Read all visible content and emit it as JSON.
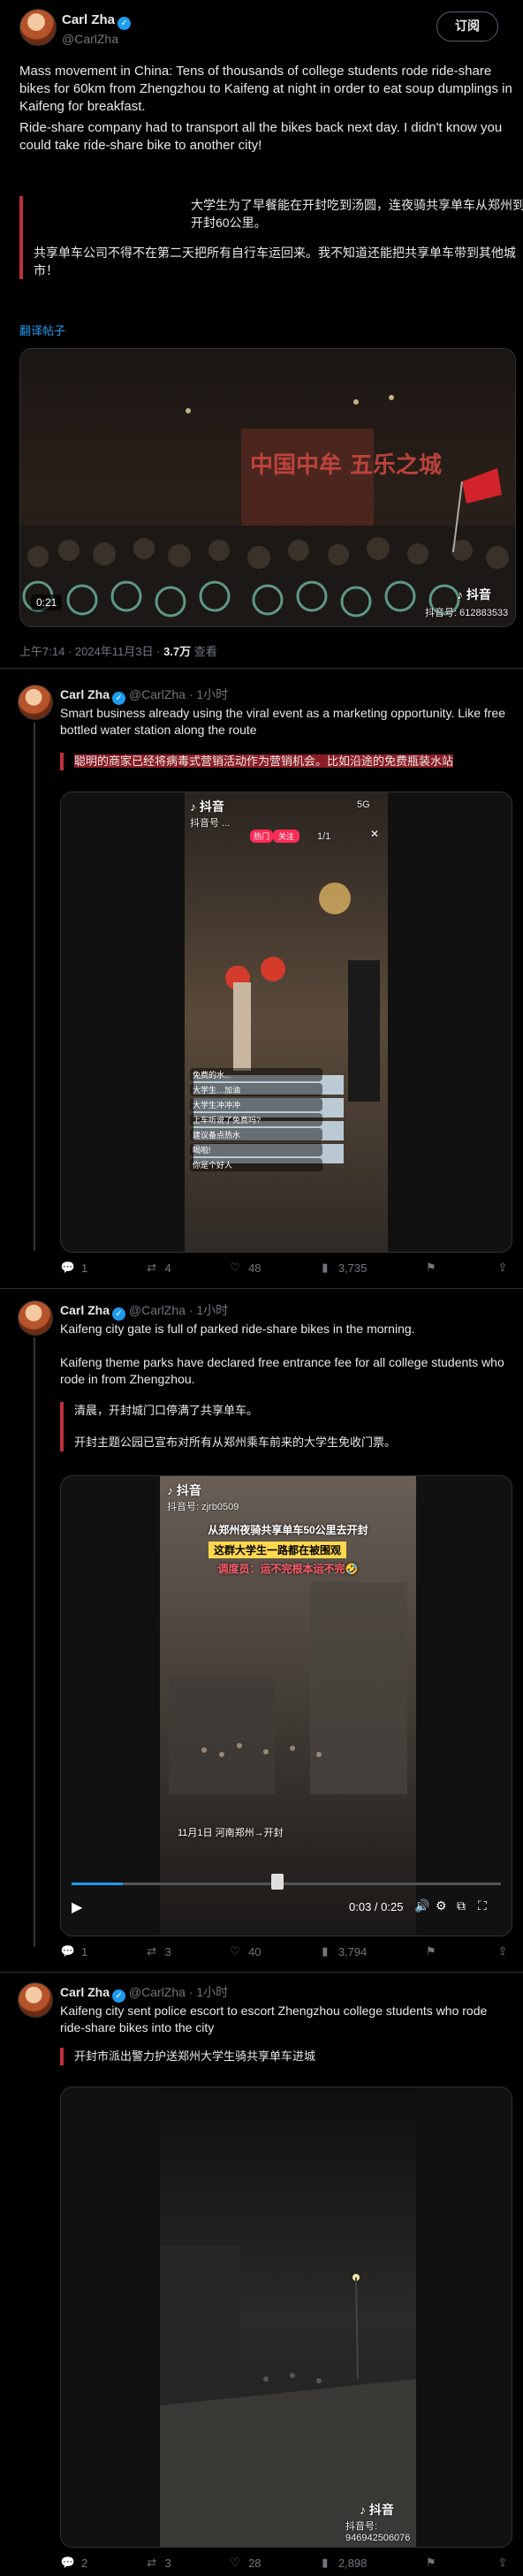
{
  "main_tweet": {
    "author_name": "Carl Zha",
    "handle": "@CarlZha",
    "subscribe_label": "订阅",
    "paragraph1": "Mass movement in China: Tens of thousands of college students rode ride-share bikes for 60km from Zhengzhou to Kaifeng at night in order to eat soup dumplings in Kaifeng for breakfast.",
    "paragraph2": "Ride-share company had to transport all the bikes back next day. I didn't know you could take ride-share bike to another city!",
    "quote_line1": "大学生为了早餐能在开封吃到汤圆，连夜骑共享单车从郑州到开封60公里。",
    "quote_line2": "共享单车公司不得不在第二天把所有自行车运回来。我不知道还能把共享单车带到其他城市！",
    "translate_label": "翻译帖子",
    "video": {
      "duration": "0:21",
      "sign_text": "中国中牟 五乐之城",
      "tiktok_logo": "抖音",
      "tiktok_id": "抖音号: 612883533"
    },
    "meta_time": "上午7:14 · 2024年11月3日 · ",
    "meta_views_count": "3.7万",
    "meta_views_label": " 查看"
  },
  "replies": [
    {
      "author_name": "Carl Zha",
      "handle": "@CarlZha",
      "time": "· 1小时",
      "text": "Smart business already using the viral event as a marketing opportunity. Like free bottled water station along the route",
      "quote": "聪明的商家已经将病毒式营销活动作为营销机会。比如沿途的免费瓶装水站",
      "video": {
        "tiktok_logo": "抖音",
        "top_left_user": "抖音号 ...",
        "badge": "热门",
        "follow": "关注",
        "count": "1/1",
        "status": "5G",
        "comments": [
          "免费的水...",
          "大学生…加油",
          "大学生冲冲冲",
          "上车听说了免费吗?",
          "建议备点热水",
          "喝啦!",
          "你是个好人"
        ]
      },
      "stats": {
        "replies": "1",
        "retweets": "4",
        "likes": "48",
        "views": "3,735"
      }
    },
    {
      "author_name": "Carl Zha",
      "handle": "@CarlZha",
      "time": "· 1小时",
      "text1": "Kaifeng city gate is full of parked ride-share bikes in the morning.",
      "text2": "Kaifeng theme parks have declared free entrance fee for all college students who rode in from Zhengzhou.",
      "quote1": "清晨，开封城门口停满了共享单车。",
      "quote2": "开封主题公园已宣布对所有从郑州乘车前来的大学生免收门票。",
      "video": {
        "tiktok_logo": "抖音",
        "tiktok_id": "抖音号: zjrb0509",
        "headline1": "从郑州夜骑共享单车50公里去开封",
        "headline2": "这群大学生一路都在被围观",
        "headline3": "调度员：运不完根本运不完🤣",
        "caption": "11月1日 河南郑州→开封",
        "time_display": "0:03 / 0:25"
      },
      "stats": {
        "replies": "1",
        "retweets": "3",
        "likes": "40",
        "views": "3,794"
      }
    },
    {
      "author_name": "Carl Zha",
      "handle": "@CarlZha",
      "time": "· 1小时",
      "text": "Kaifeng city sent police escort to escort Zhengzhou college students who rode ride-share bikes into the city",
      "quote": "开封市派出警力护送郑州大学生骑共享单车进城",
      "video": {
        "tiktok_logo": "抖音",
        "tiktok_id": "抖音号: 946942506076"
      },
      "stats": {
        "replies": "2",
        "retweets": "3",
        "likes": "28",
        "views": "2,898"
      }
    }
  ],
  "colors": {
    "accent": "#1d9bf0",
    "quote_bar": "#c0303a",
    "background": "#000000"
  }
}
